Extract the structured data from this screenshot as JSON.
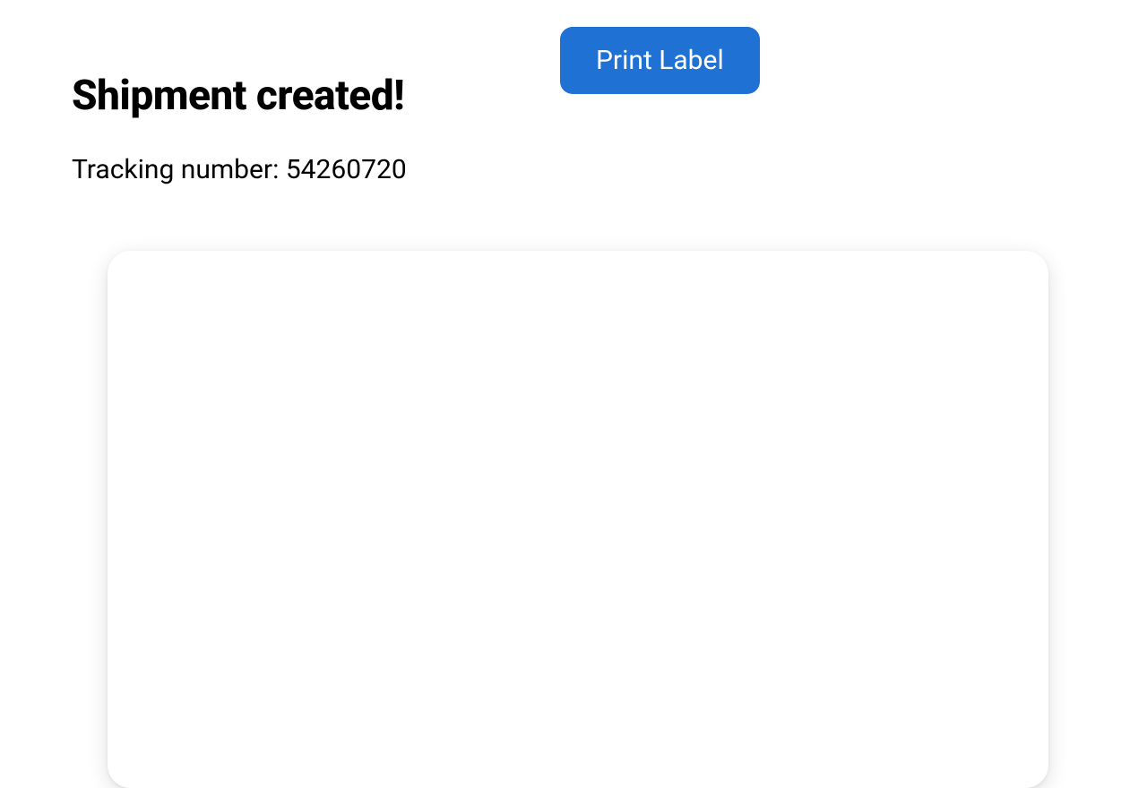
{
  "header": {
    "title": "Shipment created!",
    "tracking_label": "Tracking number: ",
    "tracking_number": "54260720"
  },
  "actions": {
    "print_label": "Print Label"
  },
  "colors": {
    "primary": "#1f71d4"
  }
}
